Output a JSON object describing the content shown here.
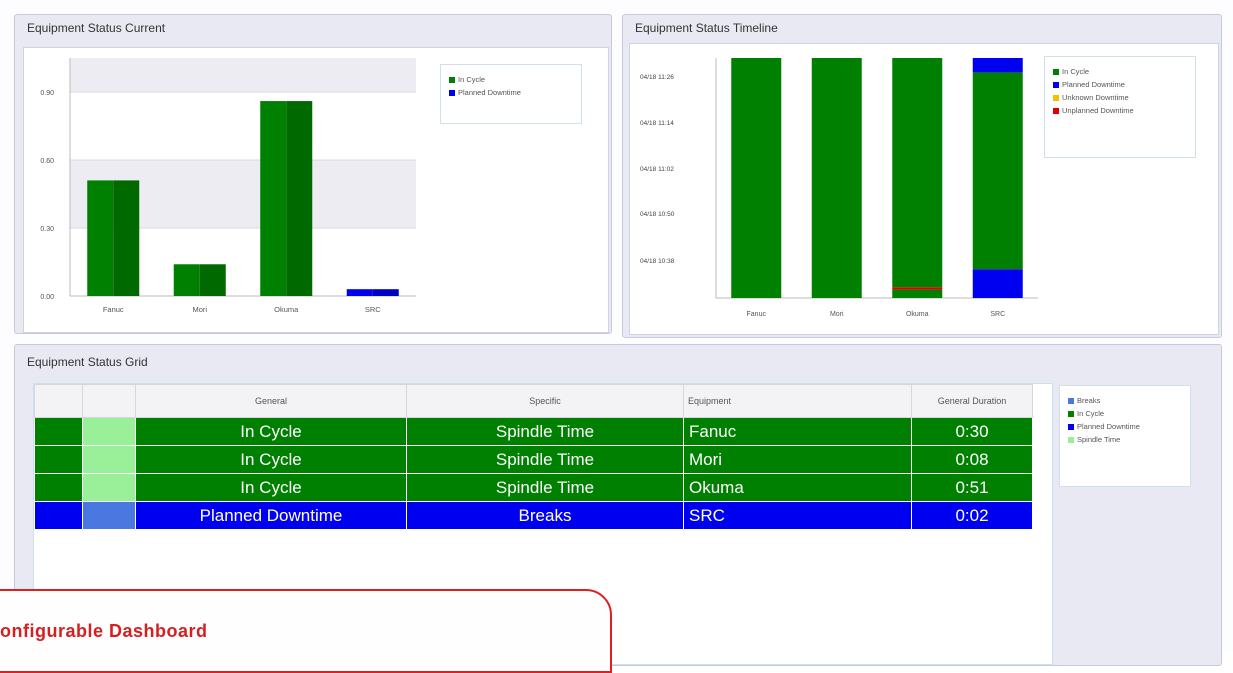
{
  "panels": {
    "current_title": "Equipment Status Current",
    "timeline_title": "Equipment Status Timeline",
    "grid_title": "Equipment Status Grid"
  },
  "chart_data": [
    {
      "type": "bar",
      "title": "Equipment Status Current",
      "categories": [
        "Fanuc",
        "Mori",
        "Okuma",
        "SRC"
      ],
      "y_tick_labels": [
        "0.00",
        "0.30",
        "0.60",
        "0.90"
      ],
      "ylim": [
        0,
        1.05
      ],
      "series": [
        {
          "name": "In Cycle",
          "color": "#008000",
          "values": [
            0.51,
            0.14,
            0.86,
            0
          ]
        },
        {
          "name": "Planned Downtime",
          "color": "#0000f0",
          "values": [
            0,
            0,
            0,
            0.03
          ]
        }
      ],
      "legend": "top-right",
      "grid": true
    },
    {
      "type": "bar",
      "title": "Equipment Status Timeline",
      "categories": [
        "Fanuc",
        "Mori",
        "Okuma",
        "SRC"
      ],
      "y_tick_labels": [
        "04/18 10:38",
        "04/18 10:50",
        "04/18 11:02",
        "04/18 11:14",
        "04/18 11:26"
      ],
      "segments": [
        [
          {
            "status": "In Cycle",
            "from": 0,
            "to": 1
          }
        ],
        [
          {
            "status": "In Cycle",
            "from": 0,
            "to": 1
          }
        ],
        [
          {
            "status": "In Cycle",
            "from": 0,
            "to": 0.035
          },
          {
            "status": "Unplanned Downtime",
            "from": 0.035,
            "to": 0.045
          },
          {
            "status": "In Cycle",
            "from": 0.045,
            "to": 1
          }
        ],
        [
          {
            "status": "Planned Downtime",
            "from": 0,
            "to": 0.12
          },
          {
            "status": "In Cycle",
            "from": 0.12,
            "to": 0.94
          },
          {
            "status": "Planned Downtime",
            "from": 0.94,
            "to": 1
          }
        ]
      ],
      "legend_items": [
        {
          "label": "In Cycle",
          "color": "#008000"
        },
        {
          "label": "Planned Downtime",
          "color": "#0000f0"
        },
        {
          "label": "Unknown Downtime",
          "color": "#f2c200"
        },
        {
          "label": "Unplanned Downtime",
          "color": "#e00000"
        }
      ],
      "legend": "top-right"
    }
  ],
  "grid": {
    "columns": [
      "",
      "",
      "General",
      "Specific",
      "Equipment",
      "General Duration"
    ],
    "rows": [
      {
        "general": "In Cycle",
        "specific": "Spindle Time",
        "equipment": "Fanuc",
        "duration": "0:30",
        "style": "green"
      },
      {
        "general": "In Cycle",
        "specific": "Spindle Time",
        "equipment": "Mori",
        "duration": "0:08",
        "style": "green"
      },
      {
        "general": "In Cycle",
        "specific": "Spindle Time",
        "equipment": "Okuma",
        "duration": "0:51",
        "style": "green"
      },
      {
        "general": "Planned Downtime",
        "specific": "Breaks",
        "equipment": "SRC",
        "duration": "0:02",
        "style": "blue"
      }
    ],
    "legend_items": [
      {
        "label": "Breaks",
        "color": "#4a78e0"
      },
      {
        "label": "In Cycle",
        "color": "#008000"
      },
      {
        "label": "Planned Downtime",
        "color": "#0000f0"
      },
      {
        "label": "Spindle Time",
        "color": "#99f099"
      }
    ]
  },
  "callout": {
    "text": "onfigurable Dashboard"
  },
  "colors": {
    "in_cycle": "#008000",
    "planned_downtime": "#0000f0",
    "unknown_downtime": "#f2c200",
    "unplanned_downtime": "#e00000",
    "accent_red": "#d42020"
  }
}
